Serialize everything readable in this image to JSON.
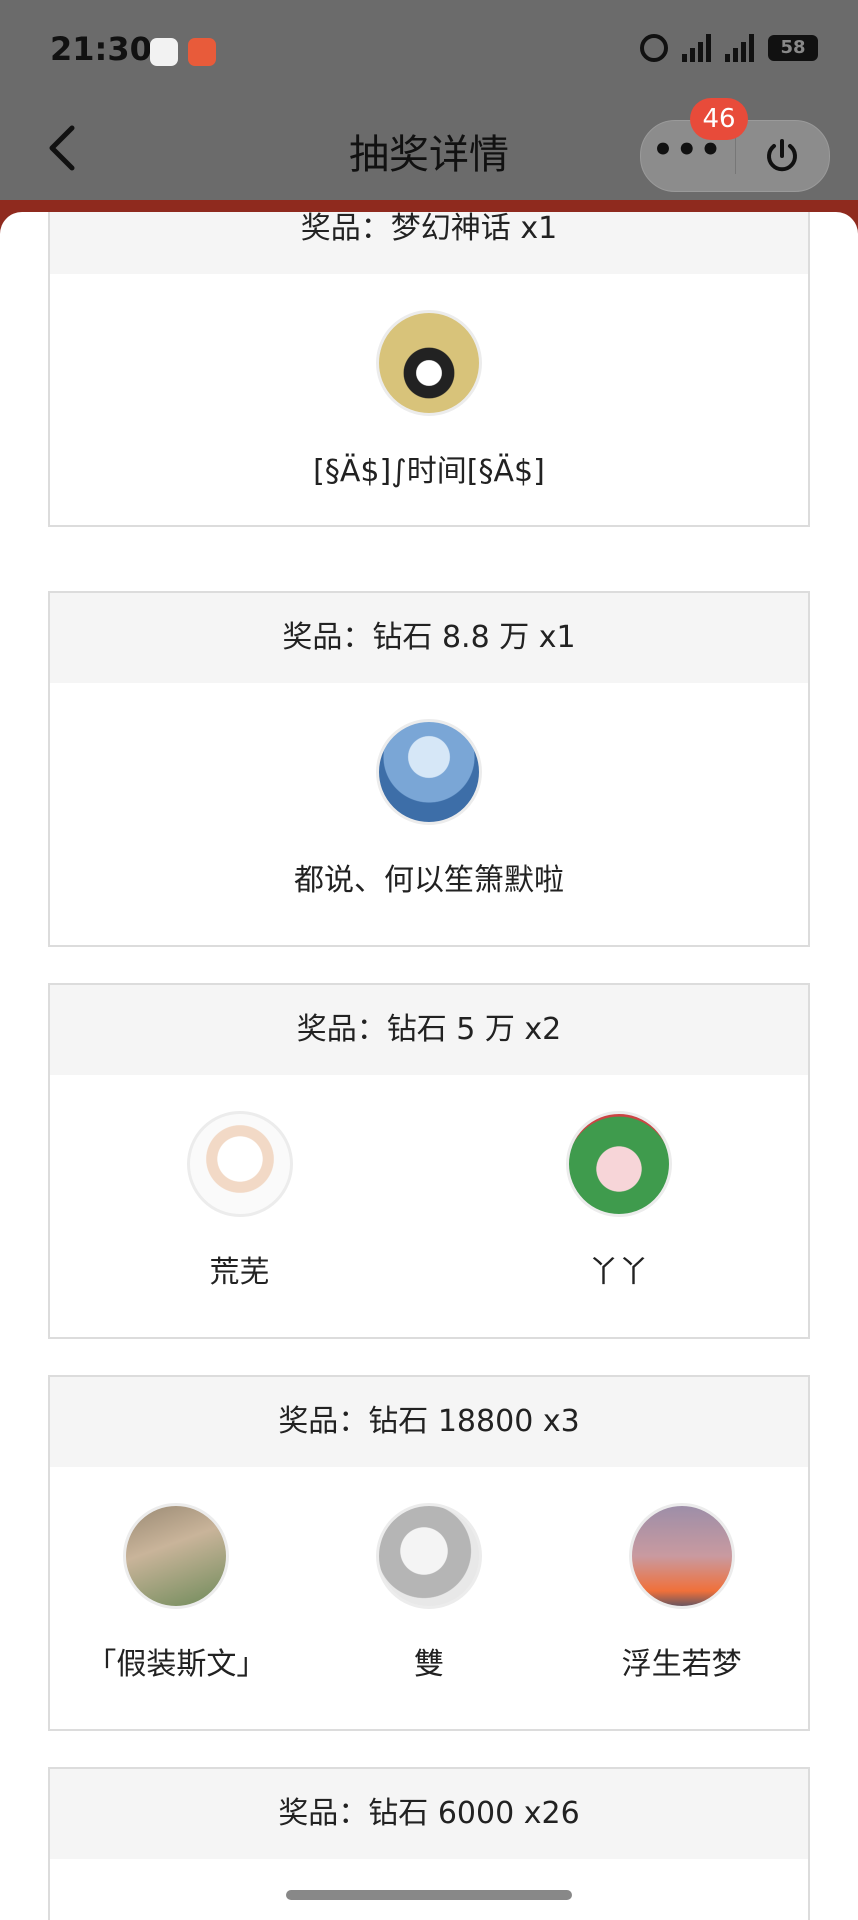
{
  "status_bar": {
    "time": "21:30",
    "battery": "58"
  },
  "nav": {
    "title": "抽奖详情",
    "badge_count": "46"
  },
  "prizes": [
    {
      "header": "奖品：梦幻神话 x1",
      "winners": [
        {
          "name": "[§Ä$]∫时间[§Ä$]"
        }
      ]
    },
    {
      "header": "奖品：钻石 8.8 万 x1",
      "winners": [
        {
          "name": "都说、何以笙箫默啦"
        }
      ]
    },
    {
      "header": "奖品：钻石 5 万 x2",
      "winners": [
        {
          "name": "荒芜"
        },
        {
          "name": "丫丫"
        }
      ]
    },
    {
      "header": "奖品：钻石 18800 x3",
      "winners": [
        {
          "name": "「假装斯文」"
        },
        {
          "name": "雙"
        },
        {
          "name": "浮生若梦"
        }
      ]
    },
    {
      "header": "奖品：钻石 6000 x26",
      "winners": []
    }
  ]
}
